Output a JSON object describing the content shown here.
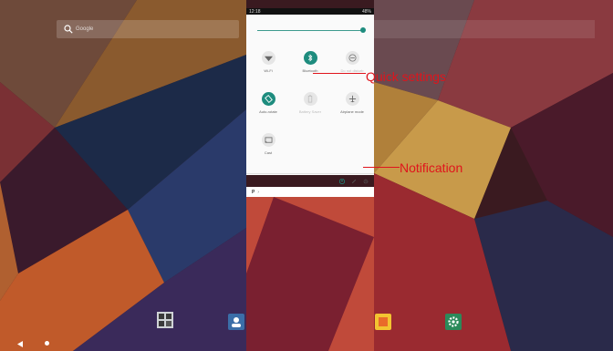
{
  "status_bar": {
    "time": "12:18",
    "battery": "48%"
  },
  "search": {
    "placeholder": "Google"
  },
  "quick_settings": {
    "tiles": [
      {
        "label": "Wi-Fi",
        "icon": "wifi-icon",
        "active": false
      },
      {
        "label": "Bluetooth",
        "icon": "bluetooth-icon",
        "active": true
      },
      {
        "label": "Do not disturb",
        "icon": "dnd-icon",
        "active": false
      },
      {
        "label": "Auto-rotate",
        "icon": "rotate-icon",
        "active": true
      },
      {
        "label": "Battery Saver",
        "icon": "battery-saver-icon",
        "active": false
      },
      {
        "label": "Airplane mode",
        "icon": "airplane-icon",
        "active": false
      },
      {
        "label": "Cast",
        "icon": "cast-icon",
        "active": false
      }
    ],
    "footer_icons": [
      "user-icon",
      "edit-icon",
      "settings-icon"
    ]
  },
  "notification": {
    "icon": "P",
    "arrow": "›"
  },
  "annotations": {
    "quick_settings": "Quick settings",
    "notification": "Notification"
  },
  "colors": {
    "accent": "#1e8c7e",
    "callout": "#e0141c"
  },
  "dock": [
    "apps-icon",
    "contacts-icon",
    "gallery-icon",
    "settings-gear-icon"
  ],
  "navigation": [
    "back-icon",
    "home-icon"
  ]
}
